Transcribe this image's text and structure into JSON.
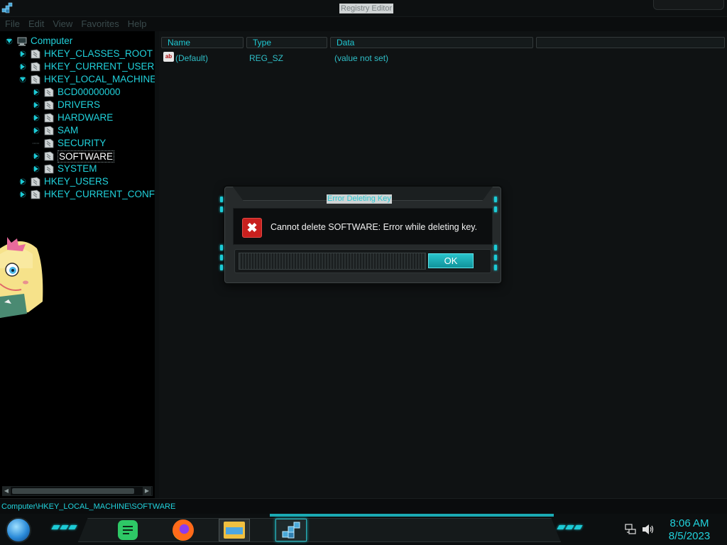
{
  "window": {
    "title": "Registry Editor"
  },
  "menu": [
    "File",
    "Edit",
    "View",
    "Favorites",
    "Help"
  ],
  "tree": [
    {
      "label": "Computer",
      "expanded": true
    },
    {
      "label": "HKEY_CLASSES_ROOT",
      "expanded": false
    },
    {
      "label": "HKEY_CURRENT_USER",
      "expanded": false
    },
    {
      "label": "HKEY_LOCAL_MACHINE",
      "expanded": true
    },
    {
      "label": "BCD00000000",
      "expanded": false
    },
    {
      "label": "DRIVERS",
      "expanded": false
    },
    {
      "label": "HARDWARE",
      "expanded": false
    },
    {
      "label": "SAM",
      "expanded": false
    },
    {
      "label": "SECURITY",
      "expanded": false
    },
    {
      "label": "SOFTWARE",
      "expanded": false,
      "selected": true
    },
    {
      "label": "SYSTEM",
      "expanded": false
    },
    {
      "label": "HKEY_USERS",
      "expanded": false
    },
    {
      "label": "HKEY_CURRENT_CONFI",
      "expanded": false
    }
  ],
  "columns": {
    "name": "Name",
    "type": "Type",
    "data": "Data"
  },
  "values": [
    {
      "name": "(Default)",
      "type": "REG_SZ",
      "data": "(value not set)",
      "icon": "string-value-icon",
      "icon_text": "ab"
    }
  ],
  "status": {
    "path": "Computer\\HKEY_LOCAL_MACHINE\\SOFTWARE"
  },
  "dialog": {
    "title": "Error Deleting Key",
    "message": "Cannot delete SOFTWARE:  Error while deleting key.",
    "ok_label": "OK",
    "icon": "error-icon",
    "icon_glyph": "✖"
  },
  "taskbar": {
    "apps": [
      {
        "name": "notes-app",
        "icon": "notes-icon"
      },
      {
        "name": "firefox",
        "icon": "firefox-icon"
      },
      {
        "name": "file-explorer",
        "icon": "folder-icon"
      },
      {
        "name": "registry-editor",
        "icon": "registry-icon",
        "active": true
      }
    ],
    "time": "8:06 AM",
    "date": "8/5/2023"
  },
  "colors": {
    "accent": "#21d2dc",
    "error": "#c8201e",
    "background": "#0b0d0e"
  }
}
